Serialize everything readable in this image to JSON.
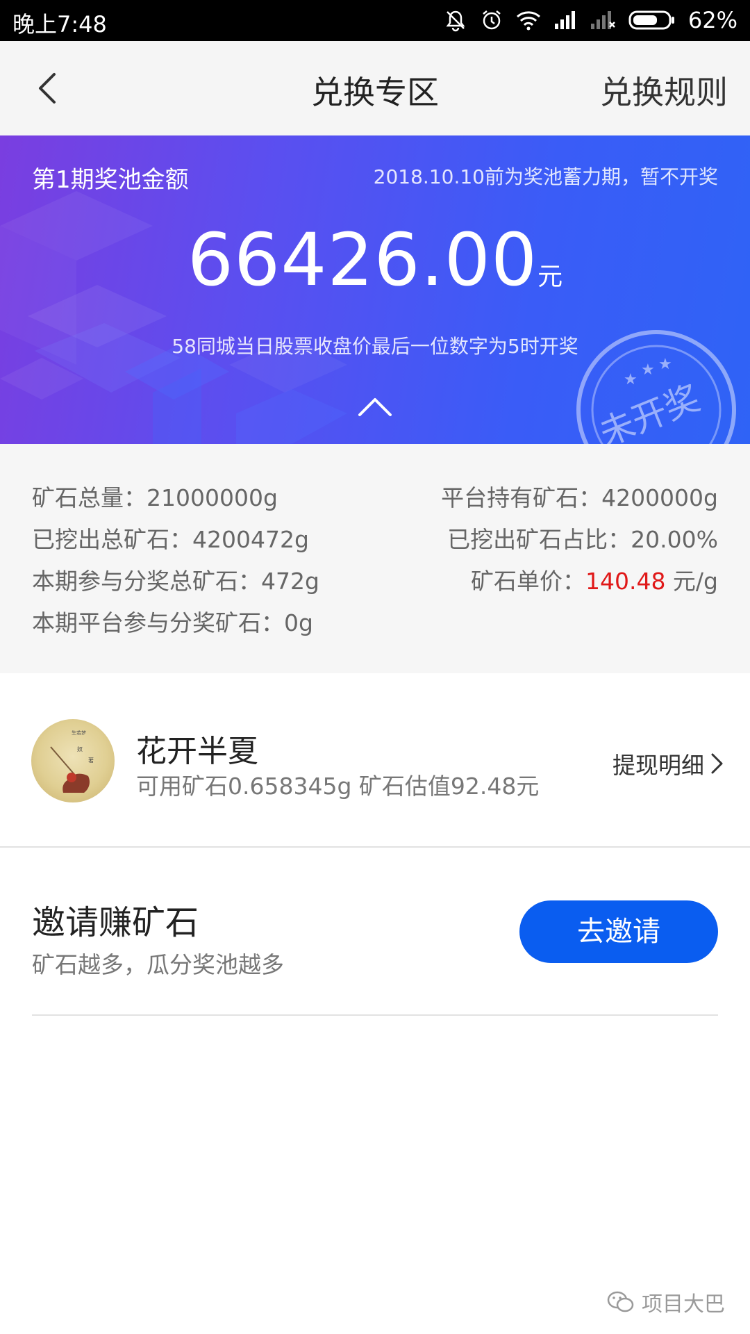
{
  "status_bar": {
    "time": "晚上7:48",
    "battery": "62%"
  },
  "header": {
    "title": "兑换专区",
    "rules_label": "兑换规则"
  },
  "banner": {
    "pool_label": "第1期奖池金额",
    "pool_note": "2018.10.10前为奖池蓄力期，暂不开奖",
    "amount": "66426.00",
    "unit": "元",
    "draw_rule": "58同城当日股票收盘价最后一位数字为5时开奖",
    "stamp_text": "未开奖",
    "gradient_start": "#7a3ee0",
    "gradient_end": "#2f63f6"
  },
  "stats": {
    "total_ore": "矿石总量：21000000g",
    "platform_ore": "平台持有矿石：4200000g",
    "mined_total": "已挖出总矿石：4200472g",
    "mined_ratio": "已挖出矿石占比：20.00%",
    "period_participating": "本期参与分奖总矿石：472g",
    "unit_price_label": "矿石单价：",
    "unit_price_value": "140.48",
    "unit_price_unit": " 元/g",
    "platform_participating": "本期平台参与分奖矿石：0g"
  },
  "user": {
    "name": "花开半夏",
    "info": "可用矿石0.658345g 矿石估值92.48元",
    "withdraw_label": "提现明细"
  },
  "invite": {
    "title": "邀请赚矿石",
    "subtitle": "矿石越多，瓜分奖池越多",
    "button_label": "去邀请"
  },
  "watermark": {
    "text": "项目大巴"
  },
  "colors": {
    "accent_blue": "#0a5df0",
    "price_red": "#e01818"
  }
}
